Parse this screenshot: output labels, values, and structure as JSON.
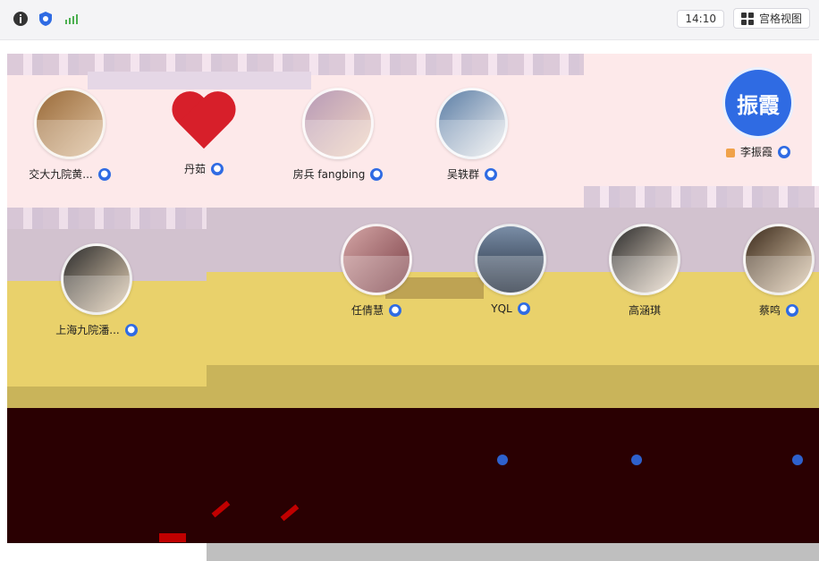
{
  "topbar": {
    "time": "14:10",
    "grid_view_label": "宫格视图",
    "icons": {
      "left": [
        "info-icon",
        "shield-icon",
        "signal-icon"
      ],
      "grid": "grid-icon"
    }
  },
  "participants": {
    "row1": [
      {
        "name": "交大九院黄...",
        "badge": true
      },
      {
        "name": "丹茹",
        "badge": true
      },
      {
        "name": "房兵 fangbing",
        "badge": true
      },
      {
        "name": "吴轶群",
        "badge": true
      }
    ],
    "right_card": {
      "name": "李振霞",
      "avatar_text": "振霞",
      "badge": true
    },
    "left_card": {
      "name": "上海九院潘...",
      "badge": true
    },
    "row2": [
      {
        "name": "任倩慧",
        "badge": true
      },
      {
        "name": "YQL",
        "badge": true
      },
      {
        "name": "高涵琪",
        "badge": false
      },
      {
        "name": "蔡鸣",
        "badge": true
      }
    ]
  },
  "colors": {
    "accent_blue": "#2f6be3",
    "pink_bg": "#fde9ea",
    "yellow_bg": "#e9d16b",
    "maroon_bg": "#2a0002",
    "red": "#d00000"
  }
}
